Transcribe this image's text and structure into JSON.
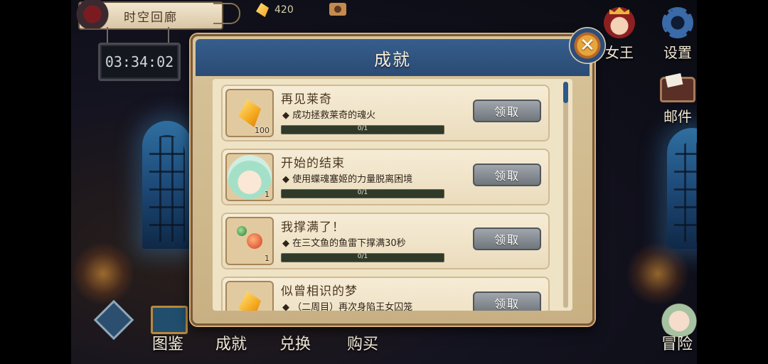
{
  "location": {
    "name": "时空回廊",
    "timer": "03:34:02"
  },
  "currency": {
    "amount": "420"
  },
  "right_menu": [
    {
      "label": "女王",
      "icon": "queen-icon"
    },
    {
      "label": "设置",
      "icon": "gear-icon"
    },
    {
      "label": "邮件",
      "icon": "mail-icon"
    }
  ],
  "bottom_menu": [
    {
      "label": "图鉴",
      "icon": "book-icon"
    },
    {
      "label": "成就",
      "icon": "trophy-icon"
    },
    {
      "label": "兑换",
      "icon": "exchange-icon"
    },
    {
      "label": "购买",
      "icon": "shop-icon"
    },
    {
      "label": "冒险",
      "icon": "adventure-icon"
    }
  ],
  "dialog": {
    "title": "成就",
    "close_symbol": "✕",
    "achievements": [
      {
        "title": "再见莱奇",
        "description": "◆ 成功拯救莱奇的魂火",
        "reward_qty": "100",
        "reward_icon": "crystal-icon",
        "progress": "0/1",
        "claim_label": "领取"
      },
      {
        "title": "开始的结束",
        "description": "◆ 使用蝶魂塞姬的力量脱离困境",
        "reward_qty": "1",
        "reward_icon": "character-portrait-icon",
        "progress": "0/1",
        "claim_label": "领取"
      },
      {
        "title": "我撑满了！",
        "description": "◆ 在三文鱼的鱼雷下撑满30秒",
        "reward_qty": "1",
        "reward_icon": "potion-icon",
        "progress": "0/1",
        "claim_label": "领取"
      },
      {
        "title": "似曾相识的梦",
        "description": "◆ （二周目）再次身陷王女囚笼",
        "reward_qty": "",
        "reward_icon": "crystal-icon",
        "progress": "",
        "claim_label": "领取"
      }
    ]
  }
}
